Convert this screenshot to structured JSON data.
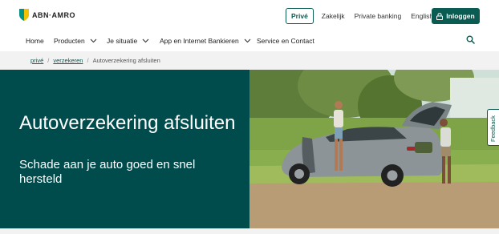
{
  "header": {
    "brand": "ABN·AMRO",
    "segments": [
      {
        "label": "Privé",
        "active": true
      },
      {
        "label": "Zakelijk",
        "active": false
      },
      {
        "label": "Private banking",
        "active": false
      },
      {
        "label": "English",
        "active": false
      }
    ],
    "login_label": "Inloggen"
  },
  "nav": {
    "items": [
      {
        "label": "Home"
      },
      {
        "label": "Producten"
      },
      {
        "label": "Je situatie"
      },
      {
        "label": "App en Internet Bankieren"
      },
      {
        "label": "Service en Contact"
      }
    ]
  },
  "breadcrumb": {
    "items": [
      "privé",
      "verzekeren",
      "Autoverzekering afsluiten"
    ],
    "separator": "/"
  },
  "hero": {
    "title": "Autoverzekering afsluiten",
    "subtitle": "Schade aan je auto goed en snel hersteld"
  },
  "feedback_label": "Feedback",
  "colors": {
    "brand_green": "#0a5b52",
    "hero_green": "#004c4c",
    "brand_yellow": "#f2c200"
  }
}
